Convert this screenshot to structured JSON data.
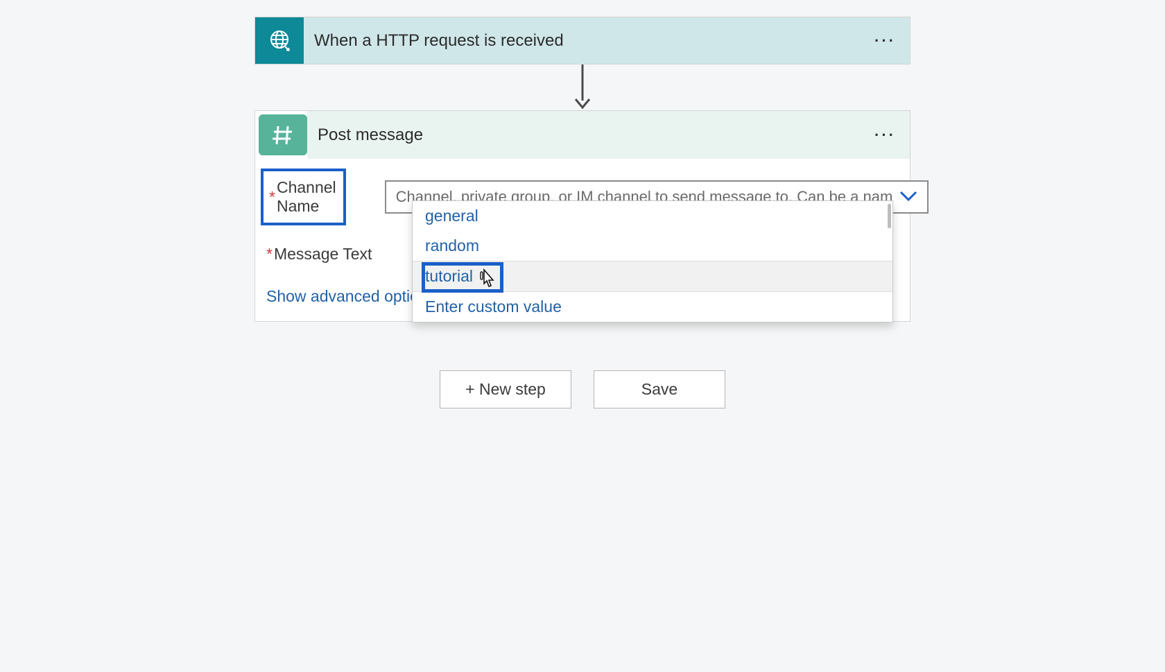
{
  "trigger": {
    "title": "When a HTTP request is received"
  },
  "action": {
    "title": "Post message",
    "fields": {
      "channel_name": {
        "label": "Channel Name",
        "placeholder": "Channel, private group, or IM channel to send message to. Can be a nam"
      },
      "message_text": {
        "label": "Message Text"
      }
    },
    "advanced_link": "Show advanced options",
    "dropdown": {
      "items": [
        "general",
        "random",
        "tutorial"
      ],
      "custom_label": "Enter custom value",
      "highlighted_index": 2
    }
  },
  "buttons": {
    "new_step": "+ New step",
    "save": "Save"
  },
  "colors": {
    "highlight_blue": "#1b5fc9",
    "link_blue": "#2261a6",
    "trigger_teal": "#0e8998",
    "action_green": "#57b39a"
  }
}
